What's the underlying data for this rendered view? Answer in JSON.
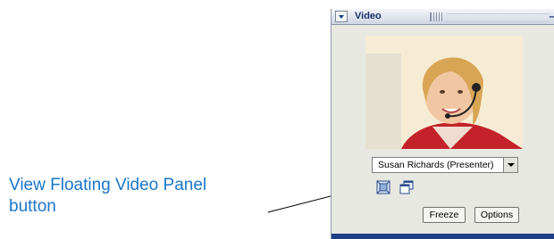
{
  "callout": {
    "text_line1": "View Floating Video Panel",
    "text_line2": "button"
  },
  "panel": {
    "title": "Video",
    "presenter_dropdown": {
      "selected": "Susan Richards (Presenter)"
    },
    "buttons": {
      "freeze": "Freeze",
      "options": "Options"
    },
    "icons": [
      "fit-video-icon",
      "view-floating-video-panel-icon"
    ]
  },
  "colors": {
    "callout_text": "#1a75c9",
    "title_text": "#1c2f6b",
    "panel_bg": "#e8e8e2",
    "bottom_bar": "#1d3f86"
  }
}
